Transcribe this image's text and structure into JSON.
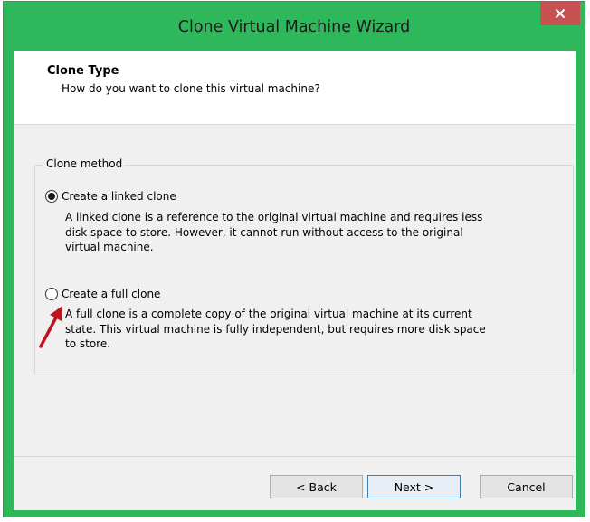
{
  "window": {
    "title": "Clone Virtual Machine Wizard",
    "close_icon": "close-icon",
    "frame_color": "#2fb85b",
    "close_color": "#c75050"
  },
  "header": {
    "title": "Clone Type",
    "subtitle": "How do you want to clone this virtual machine?"
  },
  "clone_method": {
    "legend": "Clone method",
    "options": [
      {
        "label": "Create a linked clone",
        "selected": true,
        "description": "A linked clone is a reference to the original virtual machine and requires less\ndisk space to store. However, it cannot run without access to the original\nvirtual machine."
      },
      {
        "label": "Create a full clone",
        "selected": false,
        "description": "A full clone is a complete copy of the original virtual machine at its current\nstate. This virtual machine is fully independent, but requires more disk space\nto store."
      }
    ]
  },
  "annotation": {
    "icon": "red-arrow-icon",
    "color": "#c0141c"
  },
  "buttons": {
    "back": "< Back",
    "next": "Next >",
    "cancel": "Cancel"
  }
}
